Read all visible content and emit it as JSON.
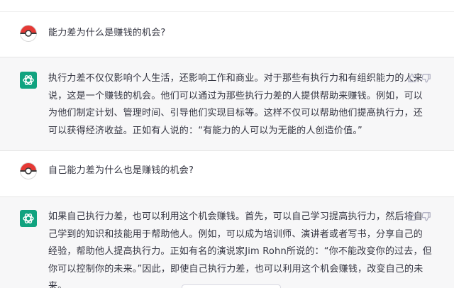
{
  "messages": [
    {
      "role": "user",
      "text": "能力差为什么是赚钱的机会?"
    },
    {
      "role": "assistant",
      "text": "执行力差不仅仅影响个人生活，还影响工作和商业。对于那些有执行力和有组织能力的人来\n说，这是一个赚钱的机会。他们可以通过为那些执行力差的人提供帮助来赚钱。例如，可以\n为他们制定计划、管理时间、引导他们实现目标等。这样不仅可以帮助他们提高执行力，还\n可以获得经济收益。正如有人说的：“有能力的人可以为无能的人创造价值。”"
    },
    {
      "role": "user",
      "text": "自己能力差为什么也是赚钱的机会?"
    },
    {
      "role": "assistant",
      "text": "如果自己执行力差，也可以利用这个机会赚钱。首先，可以自己学习提高执行力，然后将自\n己学到的知识和技能用于帮助他人。例如，可以成为培训师、演讲者或者写书，分享自己的\n经验，帮助他人提高执行力。正如有名的演说家Jim Rohn所说的：“你不能改变你的过去，但\n你可以控制你的未来。”因此，即使自己执行力差，也可以利用这个机会赚钱，改变自己的未\n来。"
    }
  ],
  "icons": {
    "user_avatar": "pokeball-avatar-icon",
    "assistant_avatar": "openai-logo-icon",
    "thumbs_up": "thumbs-up-icon",
    "thumbs_down": "thumbs-down-icon"
  },
  "colors": {
    "assistant_bg": "#f7f7f8",
    "openai_green": "#10a37f",
    "avatar_red": "#e53935",
    "text": "#343541",
    "icon_gray": "#acacbe"
  }
}
